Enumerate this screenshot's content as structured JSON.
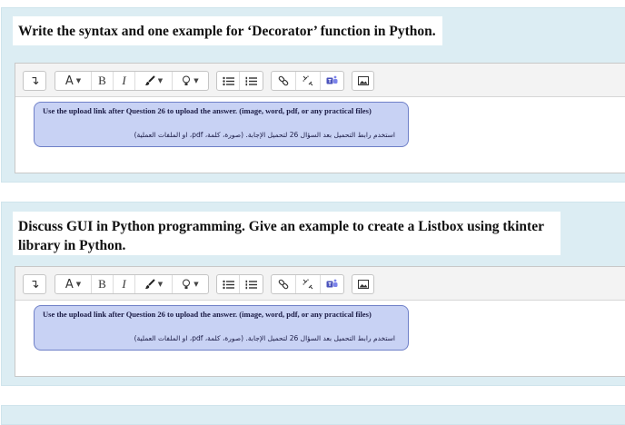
{
  "questions": [
    {
      "text": "Write the syntax and one example for ‘Decorator’ function in Python.",
      "note_en": "Use the upload link after Question 26 to upload the answer. (image, word, pdf, or any practical files)",
      "note_ar": "استخدم رابط التحميل بعد السؤال 26 لتحميل الإجابة. (صورة، كلمة، pdf، او الملفات العملية)"
    },
    {
      "text": "Discuss GUI in Python programming.  Give an example to create a Listbox using tkinter library in Python.",
      "note_en": "Use the upload link after Question 26 to upload the answer. (image, word, pdf, or any practical files)",
      "note_ar": "استخدم رابط التحميل بعد السؤال 26 لتحميل الإجابة. (صورة، كلمة، pdf، او الملفات العملية)"
    }
  ],
  "toolbar": {
    "collapse_icon": "↴",
    "font_label": "A",
    "bold_label": "B",
    "italic_label": "I",
    "caret": "▼",
    "icons": [
      "collapse-icon",
      "font-style-icon",
      "bold-icon",
      "italic-icon",
      "paint-brush-icon",
      "lightbulb-icon",
      "bullet-list-icon",
      "numbered-list-icon",
      "link-icon",
      "unlink-icon",
      "teams-icon",
      "image-icon"
    ]
  }
}
